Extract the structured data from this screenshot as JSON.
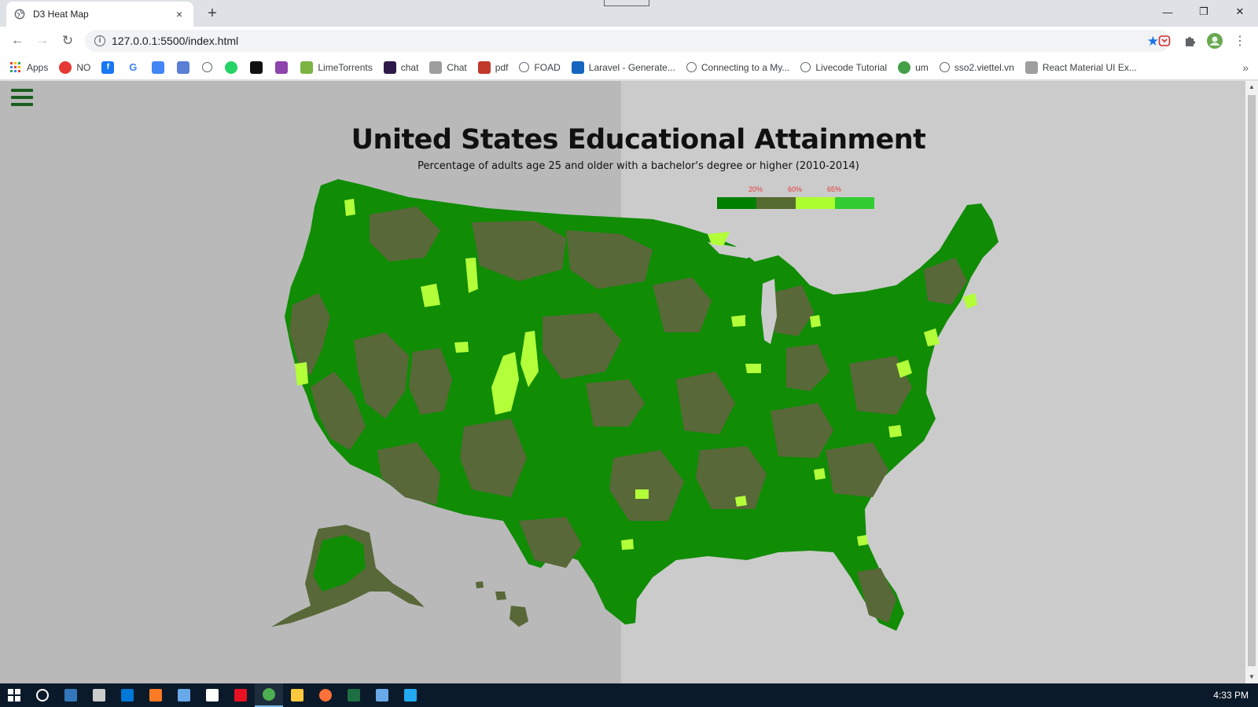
{
  "browser": {
    "tab_title": "D3 Heat Map",
    "tab_close": "×",
    "new_tab": "+",
    "url": "127.0.0.1:5500/index.html",
    "info_glyph": "i",
    "star_glyph": "★",
    "window": {
      "minimize": "—",
      "restore": "❐",
      "close": "✕"
    },
    "nav": {
      "back": "←",
      "forward": "→",
      "reload": "↻",
      "menu": "⋮"
    }
  },
  "bookmarks": {
    "items": [
      {
        "label": "Apps",
        "icon": "apps-grid-icon",
        "color": "#4285f4"
      },
      {
        "label": "NO",
        "icon": "chrome-icon",
        "color": "#e53935"
      },
      {
        "label": "",
        "icon": "facebook-icon",
        "color": "#1877f2"
      },
      {
        "label": "",
        "icon": "google-icon",
        "color": "#ffffff"
      },
      {
        "label": "",
        "icon": "translate-icon",
        "color": "#4285f4"
      },
      {
        "label": "",
        "icon": "hand-icon",
        "color": "#5b7fd6"
      },
      {
        "label": "",
        "icon": "globe-icon",
        "color": "#5f6368"
      },
      {
        "label": "",
        "icon": "whatsapp-icon",
        "color": "#25d366"
      },
      {
        "label": "",
        "icon": "app-icon",
        "color": "#111111"
      },
      {
        "label": "",
        "icon": "cube-icon",
        "color": "#8e44ad"
      },
      {
        "label": "LimeTorrents",
        "icon": "lime-icon",
        "color": "#7cb342"
      },
      {
        "label": "chat",
        "icon": "chat-app-icon",
        "color": "#2e1a47"
      },
      {
        "label": "Chat",
        "icon": "image-icon",
        "color": "#9e9e9e"
      },
      {
        "label": "pdf",
        "icon": "pdf-icon",
        "color": "#c0392b"
      },
      {
        "label": "FOAD",
        "icon": "globe-icon",
        "color": "#5f6368"
      },
      {
        "label": "Laravel - Generate...",
        "icon": "laravel-icon",
        "color": "#1565c0"
      },
      {
        "label": "Connecting to a My...",
        "icon": "globe-icon",
        "color": "#5f6368"
      },
      {
        "label": "Livecode Tutorial",
        "icon": "globe-icon",
        "color": "#5f6368"
      },
      {
        "label": "um",
        "icon": "question-icon",
        "color": "#43a047"
      },
      {
        "label": "sso2.viettel.vn",
        "icon": "globe-icon",
        "color": "#5f6368"
      },
      {
        "label": "React Material UI Ex...",
        "icon": "image-icon",
        "color": "#9e9e9e"
      }
    ],
    "overflow": "»"
  },
  "page": {
    "title": "United States Educational Attainment",
    "subtitle": "Percentage of adults age 25 and older with a bachelor's degree or higher (2010-2014)",
    "legend": {
      "labels": [
        "20%",
        "60%",
        "65%"
      ],
      "colors": [
        "#008000",
        "#556b2f",
        "#adff2f",
        "#32cd32"
      ]
    },
    "map_colors": {
      "dark_green": "#108c05",
      "olive": "#586838",
      "lime": "#b2ff3a",
      "background_left": "#b9b9b9",
      "background_right": "#cbcbcb"
    }
  },
  "taskbar": {
    "time": "4:33 PM",
    "icons": [
      "windows-start-icon",
      "cortana-icon",
      "edge-icon",
      "terminal-icon",
      "mail-icon",
      "xampp-icon",
      "app-icon",
      "store-icon",
      "media-icon",
      "chrome-icon",
      "explorer-icon",
      "firefox-icon",
      "excel-icon",
      "app-icon",
      "vscode-icon"
    ]
  }
}
